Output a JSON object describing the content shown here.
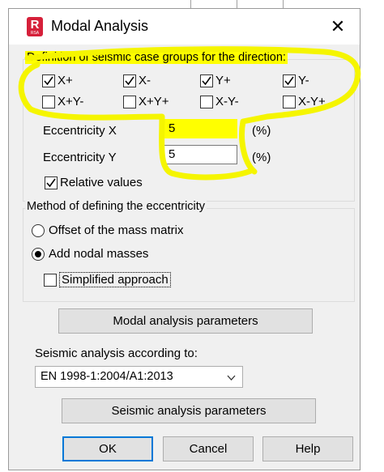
{
  "window": {
    "title": "Modal Analysis",
    "app_icon_letter": "R",
    "app_icon_sub": "RSA",
    "close_glyph": "✕"
  },
  "directions": {
    "group_label": "Definition of seismic case groups for the direction:",
    "options": [
      {
        "label": "X+",
        "checked": true
      },
      {
        "label": "X-",
        "checked": true
      },
      {
        "label": "Y+",
        "checked": true
      },
      {
        "label": "Y-",
        "checked": true
      },
      {
        "label": "X+Y-",
        "checked": false
      },
      {
        "label": "X+Y+",
        "checked": false
      },
      {
        "label": "X-Y-",
        "checked": false
      },
      {
        "label": "X-Y+",
        "checked": false
      }
    ]
  },
  "eccentricity": {
    "x_label": "Eccentricity X",
    "x_value": "5",
    "y_label": "Eccentricity Y",
    "y_value": "5",
    "unit_x": "(%)",
    "unit_y": "(%)",
    "relative_label": "Relative values",
    "relative_checked": true
  },
  "method": {
    "group_label": "Method of defining the eccentricity",
    "offset_label": "Offset of the mass matrix",
    "offset_selected": false,
    "nodal_label": "Add nodal masses",
    "nodal_selected": true,
    "simplified_label": "Simplified approach",
    "simplified_checked": false
  },
  "modal_params_button": "Modal analysis parameters",
  "seismic": {
    "label": "Seismic analysis according to:",
    "selected": "EN 1998-1:2004/A1:2013",
    "params_button": "Seismic analysis parameters"
  },
  "footer": {
    "ok": "OK",
    "cancel": "Cancel",
    "help": "Help"
  },
  "colors": {
    "highlight_yellow": "#ffff00",
    "annotation_yellow": "#f5f500",
    "focus_blue": "#0078d7",
    "revit_red": "#d6203a"
  }
}
